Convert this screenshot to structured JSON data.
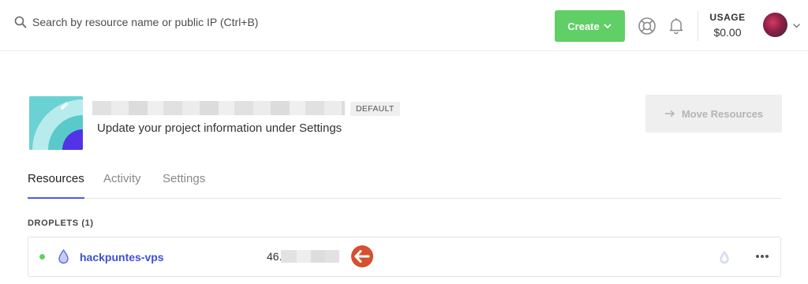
{
  "header": {
    "search_placeholder": "Search by resource name or public IP (Ctrl+B)",
    "create_label": "Create",
    "usage_label": "USAGE",
    "usage_value": "$0.00"
  },
  "project": {
    "badge": "DEFAULT",
    "subtitle": "Update your project information under Settings",
    "move_label": "Move Resources"
  },
  "tabs": [
    {
      "label": "Resources",
      "active": true
    },
    {
      "label": "Activity",
      "active": false
    },
    {
      "label": "Settings",
      "active": false
    }
  ],
  "droplets": {
    "section_title": "DROPLETS (1)",
    "rows": [
      {
        "name": "hackpuntes-vps",
        "ip_prefix": "46.",
        "status": "running"
      }
    ]
  },
  "colors": {
    "create_green": "#5fcf66",
    "link_blue": "#3d4fd8",
    "tab_underline": "#4f5ae8",
    "annotation_arrow": "#d4502f"
  }
}
